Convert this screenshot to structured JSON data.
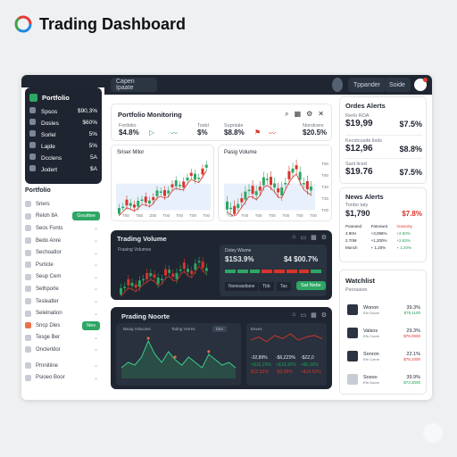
{
  "header": {
    "title": "Trading Dashboard"
  },
  "topbar": {
    "search": "Capen Ipaate",
    "btn1": "Tppander",
    "btn2": "Soide"
  },
  "sidebar": {
    "brand": "Portfolio",
    "dark_items": [
      {
        "label": "Spsos",
        "value": "$90,3%"
      },
      {
        "label": "Dosles",
        "value": "$60%"
      },
      {
        "label": "Sorlel",
        "value": "5%"
      },
      {
        "label": "Lajde",
        "value": "5%"
      },
      {
        "label": "Dcclens",
        "value": "5A"
      },
      {
        "label": "Jodert",
        "value": "$A"
      }
    ],
    "section": "Portfolio",
    "items": [
      "Sriers",
      "Reloh 8A",
      "Seos Fonts",
      "Bedo Anre",
      "Sechoatlor",
      "Psrticle",
      "Seup Cem",
      "Sethporle",
      "Tesleatler",
      "Selelnation",
      "Sncp Dles",
      "Tesge Ber",
      "Onclerldor",
      "Prnnitiine",
      "Psioeo Boor"
    ],
    "badge1": "Gouittee",
    "badge2": "Nev"
  },
  "monitoring": {
    "title": "Portfolio Monitoring",
    "labels": [
      "Fortlolio",
      "Tosbl",
      "Supnlale",
      "Norolcers"
    ],
    "values": [
      "$4.8%",
      "$%",
      "$8.8%",
      "$20.5%"
    ]
  },
  "chart_top_left": {
    "title": "Sriser Milor",
    "xticks": [
      "T00",
      "TB0",
      "Z00",
      "T00",
      "T00",
      "T00",
      "T00"
    ]
  },
  "chart_top_right": {
    "title": "Pasig Volume",
    "xticks": [
      "T00",
      "T00",
      "T00",
      "T00",
      "T00",
      "T00",
      "T00"
    ],
    "yticks": [
      "T60",
      "T50",
      "T40",
      "T30",
      "T00"
    ]
  },
  "trading_volume": {
    "title": "Trading Volume",
    "sub": "Frasing Volumes",
    "panel_title": "Doley Wisme",
    "price1": "$1S3.9%",
    "price2": "$4 $00.7%",
    "l1": "Noneasdiane",
    "l2": "Tbb",
    "l3": "Tas",
    "btn": "Sat Netie"
  },
  "prading": {
    "title": "Prading Noorte",
    "l1": "Baoig Vslucses",
    "l2": "Tadng Vsrres",
    "chip": "Cicr",
    "p1": "Eexes",
    "values": [
      "-32,89%",
      "-$6,ZZ0%",
      "-$ZZ,0",
      "+$16,Z0%",
      "+$19,30%",
      "+$0,30%",
      "$13,5Z%",
      "-$3,08%",
      "+$16.52%"
    ]
  },
  "order_alerts": {
    "title": "Ordes Alerts",
    "rows": [
      {
        "label": "Rerlo ROA",
        "value": "$19,99",
        "pct": "$7.5%"
      },
      {
        "label": "Kecstcusde lisds",
        "value": "$12,96",
        "pct": "$8.8%"
      },
      {
        "label": "Sanl liced",
        "value": "$19.76",
        "pct": "$7.5%"
      }
    ]
  },
  "news_alerts": {
    "title": "News Alerts",
    "sub": "Tonbo taty",
    "value": "$1,790",
    "pct": "$7.8%",
    "cols": [
      "Poanand",
      "Fatonwot",
      "Vonsorty"
    ],
    "rows": [
      [
        "3.90H",
        "+3,096%",
        "+2.50%"
      ],
      [
        "2.70M",
        "+1,200%",
        "+2.83%"
      ],
      [
        "Monch",
        "+ 1,20%",
        "+ 1.20%"
      ]
    ]
  },
  "watchlist": {
    "title": "Watchlist",
    "sub": "Psorasion",
    "rows": [
      {
        "name": "Wonon",
        "sub": "Efn Doore",
        "pct": "39.3%",
        "val": "$75,1100",
        "green": true
      },
      {
        "name": "Valsos",
        "sub": "Efn Coore",
        "pct": "29.3%",
        "val": "$76,0000",
        "green": false
      },
      {
        "name": "Sonron",
        "sub": "Efn Corne",
        "pct": "22.1%",
        "val": "$76,1000",
        "green": false
      },
      {
        "name": "Sosoo",
        "sub": "Efn Doore",
        "pct": "39.9%",
        "val": "$73,3000",
        "green": true
      }
    ]
  },
  "colors": {
    "green": "#1f9d55",
    "red": "#d9342b",
    "dark": "#1f2631",
    "accent": "#e53935"
  },
  "chart_data": [
    {
      "type": "line",
      "title": "Sriser Milor",
      "series": [
        {
          "values": [
            3,
            5,
            4,
            6,
            5,
            8,
            7,
            10,
            9,
            12,
            11,
            14
          ]
        }
      ]
    },
    {
      "type": "line",
      "title": "Pasig Volume",
      "series": [
        {
          "values": [
            4,
            3,
            5,
            7,
            6,
            9,
            8,
            6,
            9,
            11,
            8,
            7
          ]
        }
      ]
    },
    {
      "type": "line",
      "title": "Trading Volume",
      "series": [
        {
          "values": [
            5,
            7,
            6,
            8,
            9,
            7,
            10,
            8,
            11,
            9,
            12,
            10
          ]
        }
      ]
    },
    {
      "type": "area",
      "title": "Prading Noorte",
      "series": [
        {
          "values": [
            4,
            6,
            5,
            8,
            14,
            9,
            6,
            10,
            7,
            5,
            8,
            6,
            4,
            9,
            7,
            5,
            6,
            4
          ]
        }
      ]
    }
  ]
}
